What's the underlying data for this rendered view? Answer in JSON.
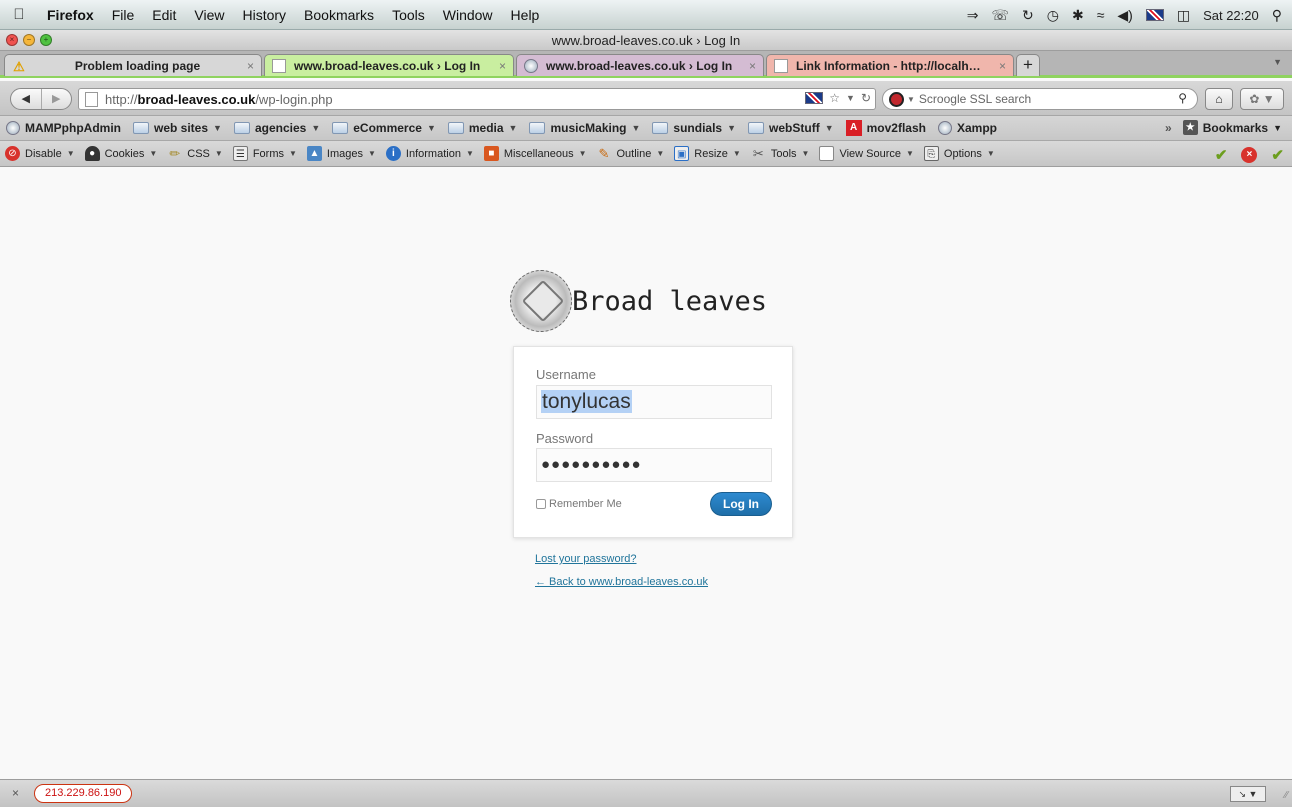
{
  "menubar": {
    "app": "Firefox",
    "items": [
      "File",
      "Edit",
      "View",
      "History",
      "Bookmarks",
      "Tools",
      "Window",
      "Help"
    ],
    "clock": "Sat 22:20"
  },
  "window": {
    "title": "www.broad-leaves.co.uk › Log In"
  },
  "tabs": [
    {
      "label": "Problem loading page",
      "close": "×"
    },
    {
      "label": "www.broad-leaves.co.uk › Log In",
      "close": "×"
    },
    {
      "label": "www.broad-leaves.co.uk › Log In",
      "close": "×"
    },
    {
      "label": "Link Information - http://localh…",
      "close": "×"
    }
  ],
  "tab_new": "+",
  "urlbar": {
    "proto": "http://",
    "host": "broad-leaves.co.uk",
    "path": "/wp-login.php"
  },
  "search": {
    "placeholder": "Scroogle SSL search"
  },
  "bookmarks": {
    "items": [
      "MAMPphpAdmin",
      "web sites",
      "agencies",
      "eCommerce",
      "media",
      "musicMaking",
      "sundials",
      "webStuff",
      "mov2flash",
      "Xampp"
    ],
    "overflow": "»",
    "menu": "Bookmarks"
  },
  "devtoolbar": {
    "items": [
      "Disable",
      "Cookies",
      "CSS",
      "Forms",
      "Images",
      "Information",
      "Miscellaneous",
      "Outline",
      "Resize",
      "Tools",
      "View Source",
      "Options"
    ]
  },
  "login": {
    "brand": "Broad leaves",
    "username_label": "Username",
    "username_value": "tonylucas",
    "password_label": "Password",
    "password_mask": "●●●●●●●●●●",
    "remember_label": "Remember Me",
    "button": "Log In",
    "lost_password": "Lost your password?",
    "back_link": "← Back to www.broad-leaves.co.uk"
  },
  "status": {
    "ip": "213.229.86.190"
  },
  "colors": {
    "link": "#21759b",
    "button": "#2e8ad0",
    "tab_active": "#c9eea0"
  }
}
